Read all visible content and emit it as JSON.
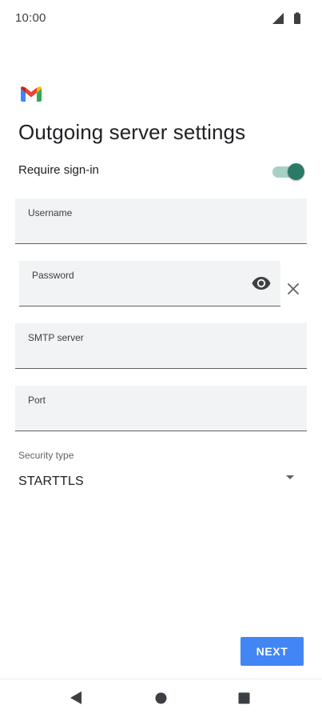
{
  "status_bar": {
    "time": "10:00",
    "icons": [
      "signal-icon",
      "battery-icon"
    ]
  },
  "app": {
    "logo": "gmail-logo"
  },
  "page": {
    "title": "Outgoing server settings"
  },
  "require_signin": {
    "label": "Require sign-in",
    "enabled": true
  },
  "fields": {
    "username": {
      "label": "Username",
      "value": ""
    },
    "password": {
      "label": "Password",
      "value": ""
    },
    "smtp_server": {
      "label": "SMTP server",
      "value": ""
    },
    "port": {
      "label": "Port",
      "value": ""
    }
  },
  "security": {
    "label": "Security type",
    "selected": "STARTTLS"
  },
  "actions": {
    "next_label": "NEXT"
  },
  "colors": {
    "accent": "#4285f4",
    "toggle_thumb": "#2b7a67",
    "toggle_track": "#a8d1c6",
    "field_background": "#f1f3f4"
  },
  "nav_bar": {
    "icons": [
      "back-icon",
      "home-icon",
      "recents-icon"
    ]
  }
}
